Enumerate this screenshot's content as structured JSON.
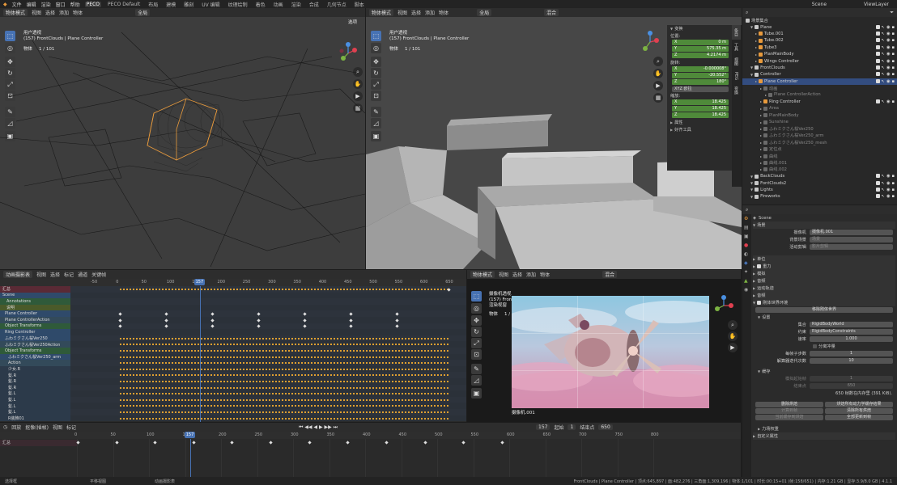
{
  "topbar": {
    "menus": [
      "文件",
      "编辑",
      "渲染",
      "窗口",
      "帮助"
    ],
    "workspaces": [
      "PECO",
      "PECO Default",
      "布局",
      "建模",
      "雕刻",
      "UV 编辑",
      "纹理绘制",
      "着色",
      "动画",
      "渲染",
      "合成",
      "几何节点",
      "脚本"
    ],
    "active_workspace": "PECO",
    "scene_label": "Scene",
    "viewlayer_label": "ViewLayer"
  },
  "vp1": {
    "mode": "物体模式",
    "menus": [
      "视图",
      "选择",
      "添加",
      "物体"
    ],
    "transform": "全局",
    "options": "选项",
    "view_name": "用户透视",
    "context": "(157) FrontClouds | Plane Controller",
    "stat_label": "物体",
    "stat_value": "1 / 101"
  },
  "vp2": {
    "mode": "物体模式",
    "menus": [
      "视图",
      "选择",
      "添加",
      "物体"
    ],
    "transform": "全局",
    "blend": "混合",
    "options": "选项",
    "view_name": "用户透视",
    "context": "(157) FrontClouds | Plane Controller",
    "stat_label": "物体",
    "stat_value": "1 / 101"
  },
  "npanel": {
    "transform_header": "变换",
    "location_label": "位置:",
    "location": [
      {
        "axis": "X",
        "value": "0 m"
      },
      {
        "axis": "Y",
        "value": "575.35 m"
      },
      {
        "axis": "Z",
        "value": "4.2174 m"
      }
    ],
    "rotation_label": "旋转:",
    "rotation": [
      {
        "axis": "X",
        "value": "-0.000008°"
      },
      {
        "axis": "Y",
        "value": "-20.552°"
      },
      {
        "axis": "Z",
        "value": "180°"
      }
    ],
    "rotation_mode": "XYZ 欧拉",
    "scale_label": "缩放:",
    "scale": [
      {
        "axis": "X",
        "value": "18.425"
      },
      {
        "axis": "Y",
        "value": "18.425"
      },
      {
        "axis": "Z",
        "value": "18.425"
      }
    ],
    "props_label": "属性",
    "tools_label": "好齐工具",
    "tabs": [
      "条目",
      "工具",
      "视图",
      "PEG",
      "变换"
    ]
  },
  "outliner": {
    "title": "场景集合",
    "rows": [
      {
        "indent": 1,
        "name": "Plane",
        "type": "col"
      },
      {
        "indent": 2,
        "name": "Tube.001",
        "type": "obj"
      },
      {
        "indent": 2,
        "name": "Tube.002",
        "type": "obj"
      },
      {
        "indent": 2,
        "name": "Tube3",
        "type": "obj"
      },
      {
        "indent": 2,
        "name": "PlanMainBody",
        "type": "obj"
      },
      {
        "indent": 2,
        "name": "Wings Controller",
        "type": "obj"
      },
      {
        "indent": 1,
        "name": "FrontClouds",
        "type": "col"
      },
      {
        "indent": 1,
        "name": "Controller",
        "type": "col"
      },
      {
        "indent": 2,
        "name": "Plane Controller",
        "type": "obj",
        "selected": true
      },
      {
        "indent": 3,
        "name": "动画",
        "type": "dim"
      },
      {
        "indent": 4,
        "name": "Plane ControllerAction",
        "type": "dim"
      },
      {
        "indent": 3,
        "name": "Ring Controller",
        "type": "obj"
      },
      {
        "indent": 3,
        "name": "Area",
        "type": "dim"
      },
      {
        "indent": 3,
        "name": "PlanMainBody",
        "type": "dim"
      },
      {
        "indent": 3,
        "name": "Sunshine",
        "type": "dim"
      },
      {
        "indent": 3,
        "name": "ふわミクさん桜Ver250",
        "type": "dim"
      },
      {
        "indent": 3,
        "name": "ふわミクさん桜Ver250_arm",
        "type": "dim"
      },
      {
        "indent": 3,
        "name": "ふわミクさん桜Ver250_mesh",
        "type": "dim"
      },
      {
        "indent": 3,
        "name": "定位点",
        "type": "dim"
      },
      {
        "indent": 3,
        "name": "曲线",
        "type": "dim"
      },
      {
        "indent": 3,
        "name": "曲线.001",
        "type": "dim"
      },
      {
        "indent": 3,
        "name": "曲线.002",
        "type": "dim"
      },
      {
        "indent": 1,
        "name": "BackClouds",
        "type": "col"
      },
      {
        "indent": 1,
        "name": "FontClouds2",
        "type": "col"
      },
      {
        "indent": 1,
        "name": "Lights",
        "type": "col"
      },
      {
        "indent": 1,
        "name": "Fireworks",
        "type": "col"
      }
    ]
  },
  "props": {
    "context": "Scene",
    "scene_header": "场景",
    "camera_label": "摄像机",
    "camera_value": "摄像机.001",
    "bg_scene_label": "背景场景",
    "active_clip_label": "活动剪辑",
    "bg_placeholder": "场景",
    "clip_placeholder": "影片剪辑",
    "panels": [
      "单位",
      "重力",
      "模拟",
      "音频",
      "运动轨迹",
      "音频"
    ],
    "gravity_label": "重力",
    "rigidbody_label": "刚体世界环境",
    "remove_rb": "移除刚体世界",
    "settings_label": "设置",
    "collection_label": "集合",
    "collection_value": "RigidBodyWorld",
    "constraints_label": "约束",
    "constraints_value": "RigidBodyConstraints",
    "speed_label": "速率",
    "speed_value": "1.000",
    "split_label": "分离冲量",
    "substeps_label": "每帧子步数",
    "substeps_value": "1",
    "iterations_label": "解算器迭代次数",
    "iterations_value": "10",
    "cache_label": "缓存",
    "sim_start_label": "模拟起始帧",
    "sim_start_value": "1",
    "sim_end_label": "结束点",
    "sim_end_value": "650",
    "cache_info": "650 帧数在内存里 (391 KiB).",
    "bake_btn": "删除烘焙",
    "bake_all_btn": "烘焙所有动力学缓存结果",
    "calc_btn": "计算到帧",
    "free_all_btn": "清除所有烘焙",
    "current_bake": "当前缓存到烘焙",
    "update_all": "全部更新到帧",
    "field_weights": "力场权重",
    "custom_props": "自定义属性"
  },
  "dopesheet": {
    "mode": "动画摄影表",
    "menus": [
      "视图",
      "选择",
      "标记",
      "通道",
      "关键帧"
    ],
    "channels": [
      "汇总",
      "Scene",
      "Annotations",
      "说明",
      "Plane Controller",
      "Plane ControllerAction",
      "Object Transforms",
      "Ring Controller",
      "ふわミクさん桜Ver250",
      "ふわミクさん桜Ver250Action",
      "Object Transforms",
      "ふわミクさん桜Ver250_arm",
      "Action",
      "少女.R",
      "髪.R",
      "髪.R",
      "髪.R",
      "髪.L",
      "髪.L",
      "髪.L",
      "髪.L",
      "R装飾01"
    ],
    "ticks": [
      "-50",
      "0",
      "50",
      "100",
      "150",
      "200",
      "250",
      "300",
      "350",
      "400",
      "450",
      "500",
      "550",
      "600",
      "650"
    ],
    "current_frame": "157",
    "playback": "回放",
    "keying": "抠像(插帧)",
    "view": "视图",
    "marker": "标记",
    "start_label": "起始",
    "start_value": "1",
    "end_label": "结束点",
    "end_value": "650",
    "frame_value": "157"
  },
  "camview": {
    "mode": "物体模式",
    "menus": [
      "视图",
      "选择",
      "添加",
      "物体"
    ],
    "blend": "混合",
    "view_name": "摄像机透视",
    "context": "(157) FrontClouds | Plane Controller",
    "extra": "渲染视窗",
    "stat_label": "物体",
    "stat_value": "1 / 101",
    "cam_name": "摄像机.001"
  },
  "timeline": {
    "ticks": [
      "0",
      "50",
      "100",
      "150",
      "200",
      "250",
      "300",
      "350",
      "400",
      "450",
      "500",
      "550",
      "600",
      "650",
      "700",
      "750",
      "800"
    ],
    "channel": "汇总",
    "current_frame": "157"
  },
  "status": {
    "left": "选择框",
    "mid": "平移视图",
    "mid2": "动画摄影表",
    "right": "FrontClouds | Plane Controller | 顶点:645,897 | 面:482,276 | 三角面:1,309,196 | 物体:1/101 | 时长:00:15+01 (帧:158/651) | 内存:1.21 GB | 显存:3.9/8.0 GB | 4.1.1"
  },
  "colors": {
    "accent": "#4772b3",
    "green": "#4f8a3a",
    "sel": "#334d80",
    "sky_top": "#8ec7e0",
    "sky_bottom": "#c88aa8"
  }
}
